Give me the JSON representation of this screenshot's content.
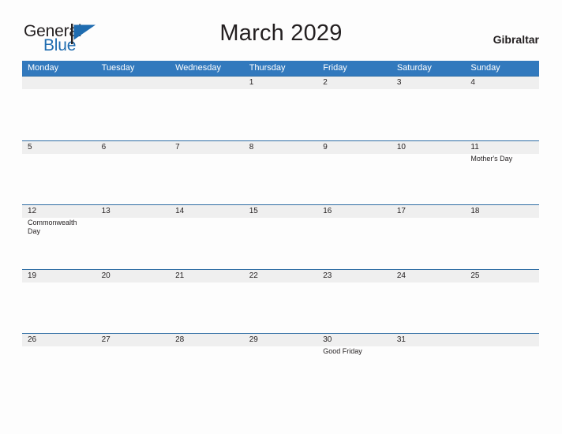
{
  "brand": {
    "name_part1": "General",
    "name_part2": "Blue",
    "flag_icon": "flag-triangle-icon",
    "color_dark": "#231f20",
    "color_blue": "#1f6cb0"
  },
  "header": {
    "title": "March 2029",
    "locale": "Gibraltar"
  },
  "calendar": {
    "accent_color": "#3279bd",
    "row_band_color": "#efefef",
    "row_rule_color": "#2e6da4",
    "weekdays": [
      "Monday",
      "Tuesday",
      "Wednesday",
      "Thursday",
      "Friday",
      "Saturday",
      "Sunday"
    ],
    "weeks": [
      [
        {
          "num": "",
          "event": ""
        },
        {
          "num": "",
          "event": ""
        },
        {
          "num": "",
          "event": ""
        },
        {
          "num": "1",
          "event": ""
        },
        {
          "num": "2",
          "event": ""
        },
        {
          "num": "3",
          "event": ""
        },
        {
          "num": "4",
          "event": ""
        }
      ],
      [
        {
          "num": "5",
          "event": ""
        },
        {
          "num": "6",
          "event": ""
        },
        {
          "num": "7",
          "event": ""
        },
        {
          "num": "8",
          "event": ""
        },
        {
          "num": "9",
          "event": ""
        },
        {
          "num": "10",
          "event": ""
        },
        {
          "num": "11",
          "event": "Mother's Day"
        }
      ],
      [
        {
          "num": "12",
          "event": "Commonwealth Day"
        },
        {
          "num": "13",
          "event": ""
        },
        {
          "num": "14",
          "event": ""
        },
        {
          "num": "15",
          "event": ""
        },
        {
          "num": "16",
          "event": ""
        },
        {
          "num": "17",
          "event": ""
        },
        {
          "num": "18",
          "event": ""
        }
      ],
      [
        {
          "num": "19",
          "event": ""
        },
        {
          "num": "20",
          "event": ""
        },
        {
          "num": "21",
          "event": ""
        },
        {
          "num": "22",
          "event": ""
        },
        {
          "num": "23",
          "event": ""
        },
        {
          "num": "24",
          "event": ""
        },
        {
          "num": "25",
          "event": ""
        }
      ],
      [
        {
          "num": "26",
          "event": ""
        },
        {
          "num": "27",
          "event": ""
        },
        {
          "num": "28",
          "event": ""
        },
        {
          "num": "29",
          "event": ""
        },
        {
          "num": "30",
          "event": "Good Friday"
        },
        {
          "num": "31",
          "event": ""
        },
        {
          "num": "",
          "event": ""
        }
      ]
    ]
  }
}
